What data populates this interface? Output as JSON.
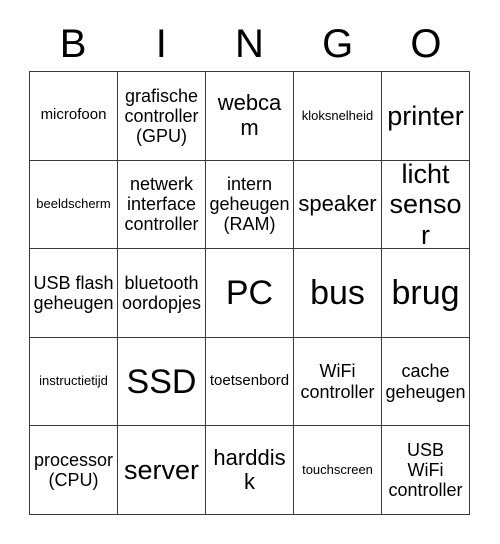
{
  "card": {
    "title": "BINGO",
    "header_letters": [
      "B",
      "I",
      "N",
      "G",
      "O"
    ],
    "columns": 5,
    "rows": 5,
    "border_color": "#3a3a3a",
    "background_color": "#ffffff",
    "text_color": "#000000",
    "cells": [
      [
        {
          "text": "microfoon",
          "size": "sm"
        },
        {
          "text": "grafische\ncontroller\n(GPU)",
          "size": "md"
        },
        {
          "text": "webcam",
          "size": "lg"
        },
        {
          "text": "kloksnelheid",
          "size": "xs"
        },
        {
          "text": "printer",
          "size": "xl"
        }
      ],
      [
        {
          "text": "beeldscherm",
          "size": "xs"
        },
        {
          "text": "netwerk\ninterface\ncontroller",
          "size": "md"
        },
        {
          "text": "intern\ngeheugen\n(RAM)",
          "size": "md"
        },
        {
          "text": "speaker",
          "size": "lg"
        },
        {
          "text": "licht\nsensor",
          "size": "xl"
        }
      ],
      [
        {
          "text": "USB flash\ngeheugen",
          "size": "md"
        },
        {
          "text": "bluetooth\noordopjes",
          "size": "md"
        },
        {
          "text": "PC",
          "size": "xxl"
        },
        {
          "text": "bus",
          "size": "xxl"
        },
        {
          "text": "brug",
          "size": "xxl"
        }
      ],
      [
        {
          "text": "instructietijd",
          "size": "xs"
        },
        {
          "text": "SSD",
          "size": "xxl"
        },
        {
          "text": "toetsenbord",
          "size": "sm"
        },
        {
          "text": "WiFi\ncontroller",
          "size": "md"
        },
        {
          "text": "cache\ngeheugen",
          "size": "md"
        }
      ],
      [
        {
          "text": "processor\n(CPU)",
          "size": "md"
        },
        {
          "text": "server",
          "size": "xl"
        },
        {
          "text": "harddisk",
          "size": "lg"
        },
        {
          "text": "touchscreen",
          "size": "xs"
        },
        {
          "text": "USB\nWiFi\ncontroller",
          "size": "md"
        }
      ]
    ]
  }
}
